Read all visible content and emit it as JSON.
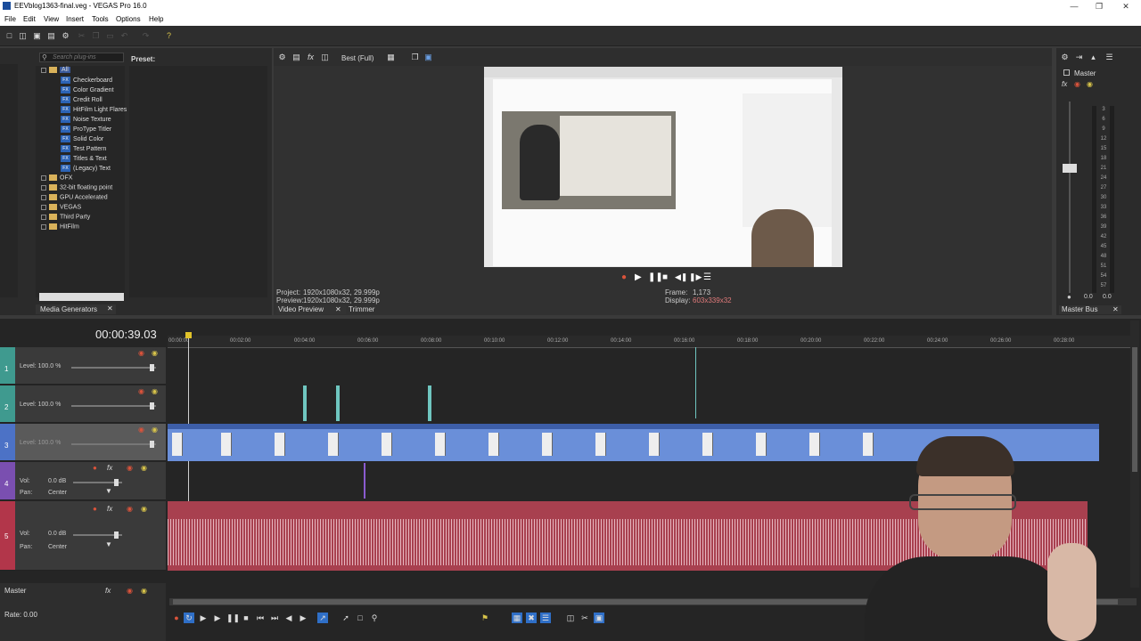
{
  "window": {
    "title": "EEVblog1363-final.veg - VEGAS Pro 16.0"
  },
  "menu": [
    "File",
    "Edit",
    "View",
    "Insert",
    "Tools",
    "Options",
    "Help"
  ],
  "explorer": {
    "search_placeholder": "Search plug-ins",
    "preset_label": "Preset:",
    "root": "All",
    "generators": [
      "Checkerboard",
      "Color Gradient",
      "Credit Roll",
      "HitFilm Light Flares",
      "Noise Texture",
      "ProType Titler",
      "Solid Color",
      "Test Pattern",
      "Titles & Text",
      "(Legacy) Text"
    ],
    "folders": [
      "OFX",
      "32-bit floating point",
      "GPU Accelerated",
      "VEGAS",
      "Third Party",
      "HitFilm"
    ],
    "tab": "Media Generators"
  },
  "preview": {
    "quality": "Best (Full)",
    "project_label": "Project:",
    "project_value": "1920x1080x32, 29.999p",
    "preview_label": "Preview:",
    "preview_value": "1920x1080x32, 29.999p",
    "frame_label": "Frame:",
    "frame_value": "1,173",
    "display_label": "Display:",
    "display_value": "603x339x32",
    "tabs": [
      "Video Preview",
      "Trimmer"
    ]
  },
  "mixer": {
    "master_label": "Master",
    "scale": [
      "3",
      "6",
      "9",
      "12",
      "15",
      "18",
      "21",
      "24",
      "27",
      "30",
      "33",
      "36",
      "39",
      "42",
      "45",
      "48",
      "51",
      "54",
      "57"
    ],
    "bottom_values": [
      "0.0",
      "0.0"
    ],
    "tab": "Master Bus"
  },
  "timeline": {
    "timecode": "00:00:39.03",
    "ruler": [
      "00:00:00",
      "00:02:00",
      "00:04:00",
      "00:06:00",
      "00:08:00",
      "00:10:00",
      "00:12:00",
      "00:14:00",
      "00:16:00",
      "00:18:00",
      "00:20:00",
      "00:22:00",
      "00:24:00",
      "00:26:00",
      "00:28:00"
    ],
    "tracks": [
      {
        "num": "1",
        "level": "Level: 100.0 %",
        "color": "#3f9a8f"
      },
      {
        "num": "2",
        "level": "Level: 100.0 %",
        "color": "#3f9a8f"
      },
      {
        "num": "3",
        "level": "Level: 100.0 %",
        "color": "#4c72c6"
      },
      {
        "num": "4",
        "vol": "Vol:",
        "vol_value": "0.0 dB",
        "pan": "Pan:",
        "pan_value": "Center",
        "color": "#7a4fb0"
      },
      {
        "num": "5",
        "vol": "Vol:",
        "vol_value": "0.0 dB",
        "pan": "Pan:",
        "pan_value": "Center",
        "color": "#b2364a"
      }
    ],
    "master_label": "Master",
    "rate_label": "Rate: 0.00"
  }
}
